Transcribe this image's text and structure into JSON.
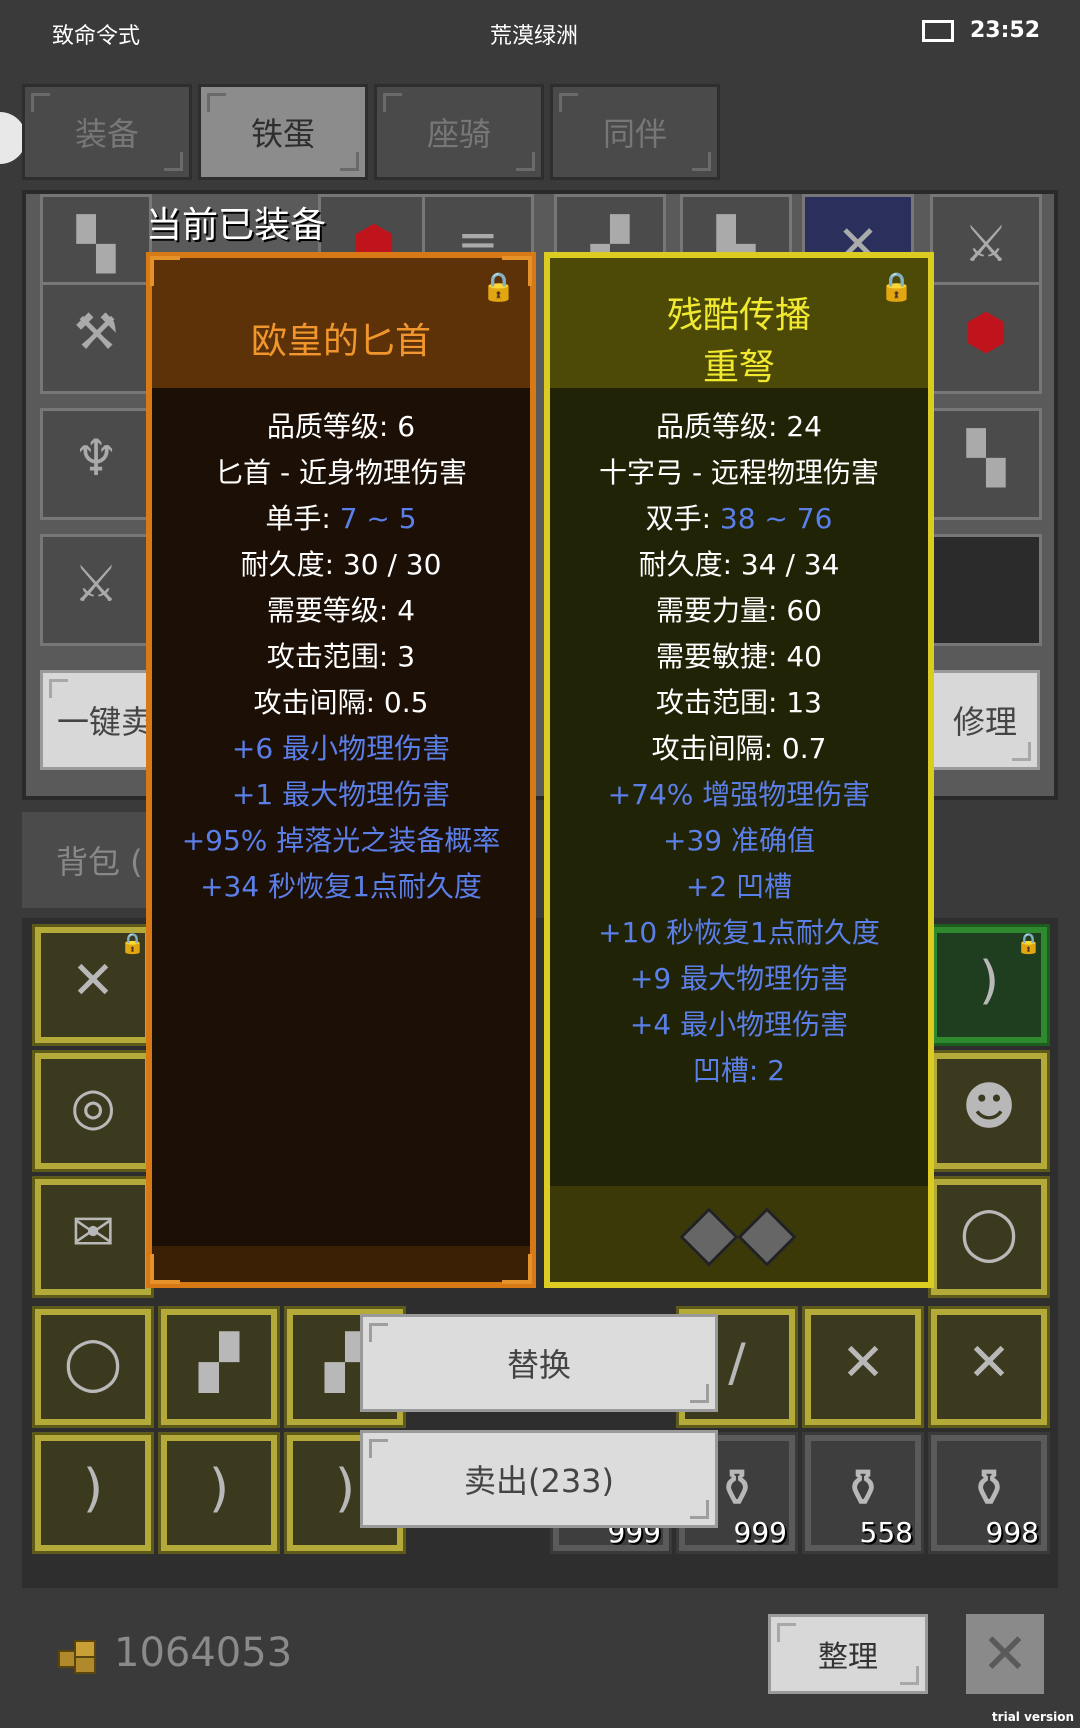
{
  "status_bar": {
    "left": "致命令式",
    "center": "荒漠绿洲",
    "time": "23:52"
  },
  "tabs": [
    {
      "label": "装备"
    },
    {
      "label": "铁蛋"
    },
    {
      "label": "座骑"
    },
    {
      "label": "同伴"
    }
  ],
  "active_tab": "铁蛋",
  "equip_buttons": {
    "sell_all": "一键卖",
    "repair": "修理"
  },
  "bag": {
    "tab_label": "背包 ("
  },
  "bag_counts": [
    "999",
    "999",
    "558",
    "998"
  ],
  "tooltip": {
    "header": "当前已装备",
    "left": {
      "title": "欧皇的匕首",
      "lines": [
        {
          "text": "品质等级: 6"
        },
        {
          "text": "匕首 - 近身物理伤害"
        },
        {
          "prefix": "单手: ",
          "value": "7 ~ 5"
        },
        {
          "text": "耐久度: 30 / 30"
        },
        {
          "text": "需要等级: 4"
        },
        {
          "text": "攻击范围: 3"
        },
        {
          "text": "攻击间隔: 0.5"
        }
      ],
      "bonuses": [
        "+6 最小物理伤害",
        "+1 最大物理伤害",
        "+95% 掉落光之装备概率",
        "+34 秒恢复1点耐久度"
      ]
    },
    "right": {
      "title_line1": "残酷传播",
      "title_line2": "重弩",
      "lines": [
        {
          "text": "品质等级: 24"
        },
        {
          "text": "十字弓 - 远程物理伤害"
        },
        {
          "prefix": "双手: ",
          "value": "38 ~ 76"
        },
        {
          "text": "耐久度: 34 / 34"
        },
        {
          "text": "需要力量: 60"
        },
        {
          "text": "需要敏捷: 40"
        },
        {
          "text": "攻击范围: 13"
        },
        {
          "text": "攻击间隔: 0.7"
        }
      ],
      "bonuses": [
        "+74% 增强物理伤害",
        "+39 准确值",
        "+2 凹槽",
        "+10 秒恢复1点耐久度",
        "+9 最大物理伤害",
        "+4 最小物理伤害",
        "凹槽: 2"
      ]
    }
  },
  "actions": {
    "replace": "替换",
    "sell": "卖出(233)"
  },
  "footer": {
    "gold": "1064053",
    "sort": "整理"
  },
  "watermark": "trial version",
  "colors": {
    "left_border": "#d77a16",
    "right_border": "#dccc22",
    "bonus_blue": "#5b7fe8",
    "bag_slot": "#b4aa3a"
  }
}
